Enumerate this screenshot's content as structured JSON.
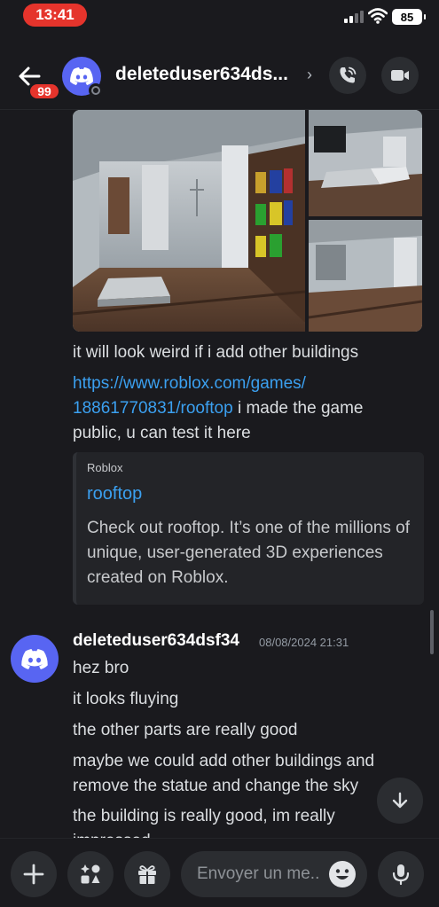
{
  "status_bar": {
    "time": "13:41",
    "battery": "85"
  },
  "header": {
    "unread_count": "99",
    "username": "deleteduser634ds...",
    "chevron": "›"
  },
  "messages": {
    "line1": "it will look weird if i add other buildings",
    "link_text": "https://www.roblox.com/games/18861770831/rooftop",
    "link_line1": "https://www.roblox.com/games/",
    "link_line2": "18861770831/rooftop",
    "after_link": " i made the game public, u can test it here",
    "after_link_1": " i made the game",
    "after_link_2": "public, u can test it here"
  },
  "embed": {
    "provider": "Roblox",
    "title": "rooftop",
    "description": "Check out rooftop. It’s one of the millions of unique, user-generated 3D experiences created on Roblox."
  },
  "group2": {
    "author": "deleteduser634dsf34",
    "timestamp": "08/08/2024 21:31",
    "lines": [
      "hez bro",
      "it looks fluying",
      "the other parts are really good",
      "maybe we could add other buildings and remove the statue and change the sky",
      "the building is really good, im really impressed"
    ]
  },
  "composer": {
    "placeholder": "Envoyer un me.."
  },
  "colors": {
    "accent": "#5865f2",
    "link": "#3ba0f0",
    "badge": "#e5342c",
    "background": "#1a1a1e"
  },
  "icons": [
    "back-arrow-icon",
    "discord-logo-icon",
    "phone-call-icon",
    "video-camera-icon",
    "plus-icon",
    "apps-icon",
    "gift-icon",
    "emoji-icon",
    "microphone-icon",
    "arrow-down-icon"
  ]
}
